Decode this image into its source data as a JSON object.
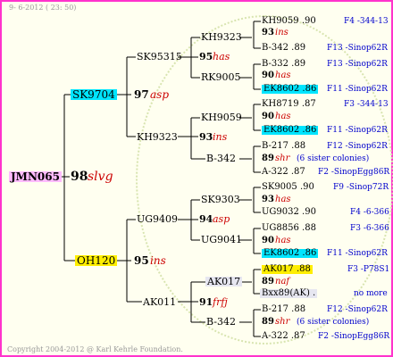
{
  "header": {
    "date": "9-  6-2012 ( 23: 50)"
  },
  "footer": {
    "copyright": "Copyright 2004-2012 @ Karl Kehrle Foundation."
  },
  "colors": {
    "border": "#ff33cc",
    "cyan": "#00e5ff",
    "yellow": "#ffee00",
    "pink": "#ffbbff",
    "red": "#cc0000",
    "blue": "#0000cc"
  },
  "root": {
    "id": "JMN065",
    "year": "98",
    "race": "slvg"
  },
  "gen1": [
    {
      "id": "SK9704",
      "year": "97",
      "race": "asp"
    },
    {
      "id": "OH120",
      "year": "95",
      "race": "ins"
    }
  ],
  "gen2": [
    {
      "id": "SK95315",
      "year": "95",
      "race": "has"
    },
    {
      "id": "KH9323",
      "year": "93",
      "race": "ins"
    },
    {
      "id": "UG9409",
      "year": "94",
      "race": "asp"
    },
    {
      "id": "AK011",
      "year": "91",
      "race": "frfj"
    }
  ],
  "gen3": [
    {
      "id": "KH9323"
    },
    {
      "id": "RK9005"
    },
    {
      "id": "KH9059"
    },
    {
      "id": "B-342"
    },
    {
      "id": "SK9303"
    },
    {
      "id": "UG9041"
    },
    {
      "id": "AK017"
    },
    {
      "id": "B-342"
    }
  ],
  "gen4": [
    {
      "text": "KH9059 .90",
      "source": "F4 -344-13"
    },
    {
      "text": "93",
      "race": "ins"
    },
    {
      "text": "B-342 .89",
      "source": "F13 -Sinop62R"
    },
    {
      "text": "B-332 .89",
      "source": "F13 -Sinop62R"
    },
    {
      "text": "90",
      "race": "has"
    },
    {
      "text": "EK8602 .86",
      "source": "F11 -Sinop62R"
    },
    {
      "text": "KH8719 .87",
      "source": "F3 -344-13"
    },
    {
      "text": "90",
      "race": "has"
    },
    {
      "text": "EK8602 .86",
      "source": "F11 -Sinop62R"
    },
    {
      "text": "B-217 .88",
      "source": "F12 -Sinop62R"
    },
    {
      "text": "89",
      "race": "shr",
      "note": "(6 sister colonies)"
    },
    {
      "text": "A-322 .87",
      "source": "F2 -SinopEgg86R"
    },
    {
      "text": "SK9005 .90",
      "source": "F9 -Sinop72R"
    },
    {
      "text": "93",
      "race": "has"
    },
    {
      "text": "UG9032 .90",
      "source": "F4 -6-366"
    },
    {
      "text": "UG8856 .88",
      "source": "F3 -6-366"
    },
    {
      "text": "90",
      "race": "has"
    },
    {
      "text": "EK8602 .86",
      "source": "F11 -Sinop62R"
    },
    {
      "text": "AK017 .88",
      "source": "F3 -P78S1"
    },
    {
      "text": "89",
      "race": "naf"
    },
    {
      "text": "Bxx89(AK) .",
      "source": "no more"
    },
    {
      "text": "B-217 .88",
      "source": "F12 -Sinop62R"
    },
    {
      "text": "89",
      "race": "shr",
      "note": "(6 sister colonies)"
    },
    {
      "text": "A-322 .87",
      "source": "F2 -SinopEgg86R"
    }
  ]
}
